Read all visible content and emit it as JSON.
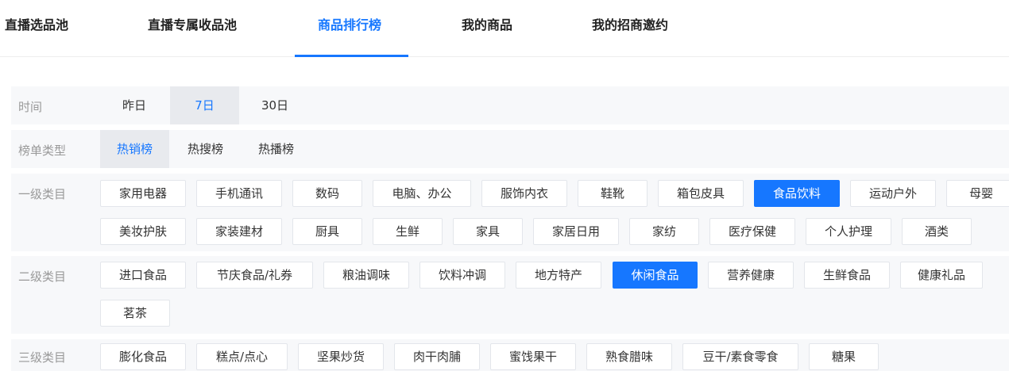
{
  "tabs": [
    "直播选品池",
    "直播专属收品池",
    "商品排行榜",
    "我的商品",
    "我的招商邀约"
  ],
  "active_tab": "商品排行榜",
  "filters": {
    "time": {
      "label": "时间",
      "options": [
        "昨日",
        "7日",
        "30日"
      ],
      "selected": "7日"
    },
    "list_type": {
      "label": "榜单类型",
      "options": [
        "热销榜",
        "热搜榜",
        "热播榜"
      ],
      "selected": "热销榜"
    },
    "level1": {
      "label": "一级类目",
      "row1": [
        "家用电器",
        "手机通讯",
        "数码",
        "电脑、办公",
        "服饰内衣",
        "鞋靴",
        "箱包皮具",
        "食品饮料",
        "运动户外",
        "母婴"
      ],
      "row2": [
        "美妆护肤",
        "家装建材",
        "厨具",
        "生鲜",
        "家具",
        "家居日用",
        "家纺",
        "医疗保健",
        "个人护理",
        "酒类"
      ],
      "selected": "食品饮料"
    },
    "level2": {
      "label": "二级类目",
      "row1": [
        "进口食品",
        "节庆食品/礼券",
        "粮油调味",
        "饮料冲调",
        "地方特产",
        "休闲食品",
        "营养健康",
        "生鲜食品",
        "健康礼品"
      ],
      "row2": [
        "茗茶"
      ],
      "selected": "休闲食品"
    },
    "level3": {
      "label": "三级类目",
      "row1": [
        "膨化食品",
        "糕点/点心",
        "坚果炒货",
        "肉干肉脯",
        "蜜饯果干",
        "熟食腊味",
        "豆干/素食零食",
        "糖果"
      ]
    }
  },
  "colors": {
    "accent": "#1677ff",
    "band": "#f7f8fa",
    "label": "#999999"
  }
}
